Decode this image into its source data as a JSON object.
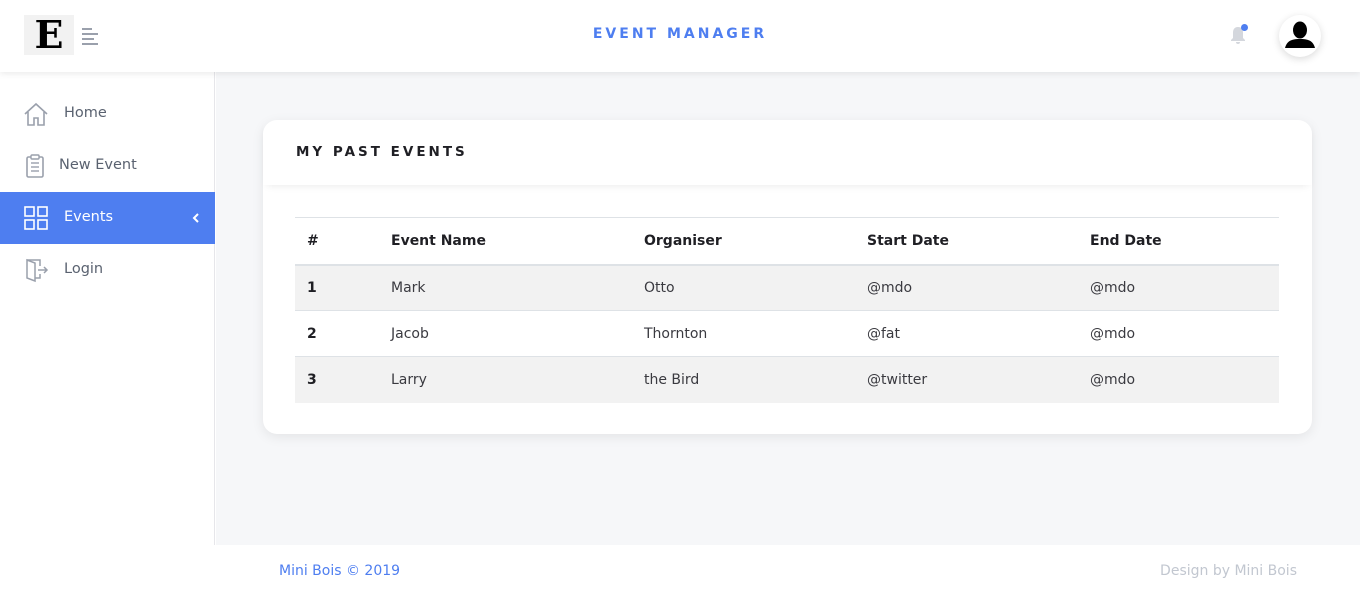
{
  "header": {
    "logo_letter": "E",
    "app_title": "EVENT MANAGER",
    "accent_color": "#4e7ef0",
    "menu_icon": "hamburger-icon",
    "notification_icon": "bell-icon",
    "avatar_icon": "user-icon"
  },
  "sidebar": {
    "items": [
      {
        "label": "Home",
        "icon": "home-icon",
        "active": false
      },
      {
        "label": "New Event",
        "icon": "clipboard-icon",
        "active": false
      },
      {
        "label": "Events",
        "icon": "grid-icon",
        "active": true
      },
      {
        "label": "Login",
        "icon": "login-icon",
        "active": false
      }
    ]
  },
  "card": {
    "title": "MY PAST EVENTS",
    "table": {
      "columns": [
        "#",
        "Event Name",
        "Organiser",
        "Start Date",
        "End Date"
      ],
      "rows": [
        [
          "1",
          "Mark",
          "Otto",
          "@mdo",
          "@mdo"
        ],
        [
          "2",
          "Jacob",
          "Thornton",
          "@fat",
          "@mdo"
        ],
        [
          "3",
          "Larry",
          "the Bird",
          "@twitter",
          "@mdo"
        ]
      ]
    }
  },
  "footer": {
    "copyright": "Mini Bois © 2019",
    "design_credit": "Design by Mini Bois"
  }
}
